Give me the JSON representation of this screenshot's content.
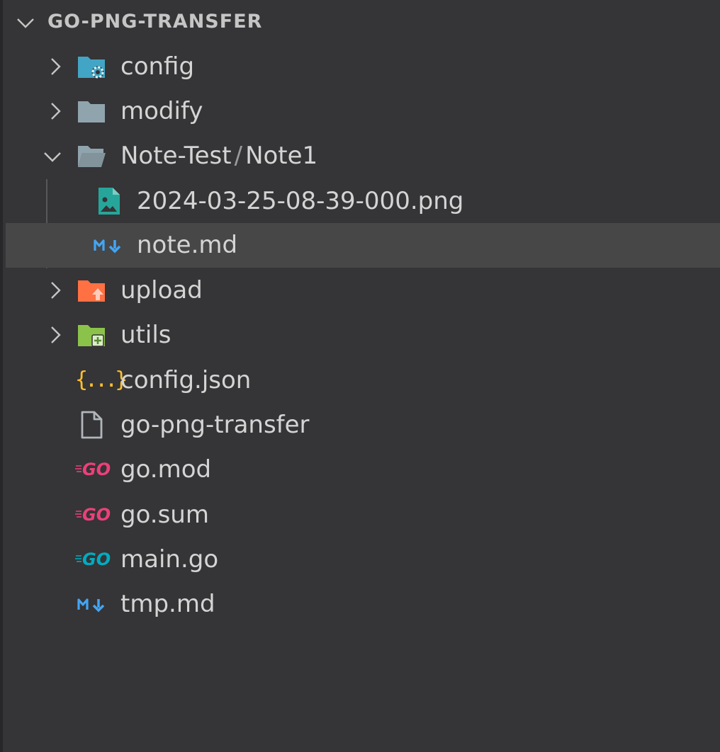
{
  "explorer": {
    "title": "GO-PNG-TRANSFER",
    "items": [
      {
        "label": "config",
        "type": "folder",
        "icon": "folder-config-icon"
      },
      {
        "label": "modify",
        "type": "folder",
        "icon": "folder-icon"
      },
      {
        "label": "Note-Test",
        "sublabel": "Note1",
        "separator": "/",
        "type": "folder-open",
        "icon": "folder-open-icon"
      },
      {
        "label": "2024-03-25-08-39-000.png",
        "type": "file",
        "icon": "image-file-icon"
      },
      {
        "label": "note.md",
        "type": "file",
        "icon": "markdown-icon",
        "selected": true
      },
      {
        "label": "upload",
        "type": "folder",
        "icon": "folder-upload-icon"
      },
      {
        "label": "utils",
        "type": "folder",
        "icon": "folder-utils-icon"
      },
      {
        "label": "config.json",
        "type": "file",
        "icon": "json-icon",
        "icon_text": "{...}"
      },
      {
        "label": "go-png-transfer",
        "type": "file",
        "icon": "file-icon"
      },
      {
        "label": "go.mod",
        "type": "file",
        "icon": "go-mod-icon",
        "icon_text": "GO"
      },
      {
        "label": "go.sum",
        "type": "file",
        "icon": "go-sum-icon",
        "icon_text": "GO"
      },
      {
        "label": "main.go",
        "type": "file",
        "icon": "go-icon",
        "icon_text": "GO"
      },
      {
        "label": "tmp.md",
        "type": "file",
        "icon": "markdown-icon"
      }
    ]
  },
  "colors": {
    "background": "#353436",
    "selected_row": "#474747",
    "text": "#d4d4d4",
    "folder_config": "#42a5c5",
    "folder_default": "#90a4ae",
    "folder_upload": "#ff7043",
    "folder_utils": "#8bc34a",
    "image_file": "#26a69a",
    "markdown": "#42a5f5",
    "json": "#fbc02d",
    "go_mod": "#ec407a",
    "go_main": "#00acc1"
  }
}
